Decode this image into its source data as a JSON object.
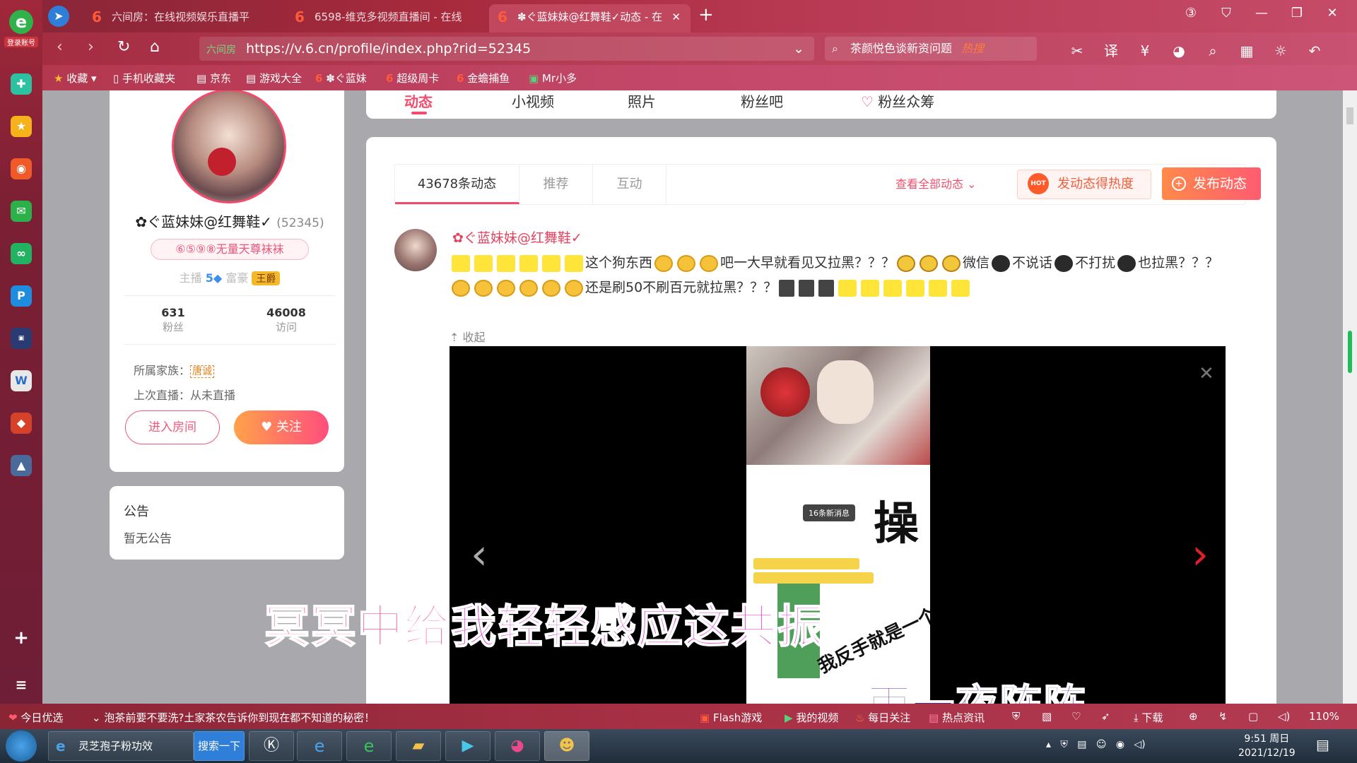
{
  "app": {
    "login_label": "登录账号"
  },
  "tabs": [
    {
      "label": "六间房：在线视频娱乐直播平"
    },
    {
      "label": "6598-维克多视频直播间 - 在线"
    },
    {
      "label": "✽ぐ蓝妹妹@红舞鞋✓动态 - 在"
    }
  ],
  "address": {
    "site_label": "六间房",
    "url": "https://v.6.cn/profile/index.php?rid=52345"
  },
  "search": {
    "text": "茶颜悦色谈新资问题",
    "hot": "热搜"
  },
  "bookmarks": [
    "收藏",
    "手机收藏夹",
    "京东",
    "游戏大全",
    "✽ぐ蓝妹",
    "超级周卡",
    "金蟾捕鱼",
    "Mr小多"
  ],
  "profile": {
    "name": "✿ぐ蓝妹妹@红舞鞋✓",
    "id": "(52345)",
    "badge": "⑥⑤⑨⑧无量天尊袜袜",
    "anchor_label": "主播",
    "anchor_level": "5",
    "rich_label": "富豪",
    "rich_title": "王爵",
    "fans_value": "631",
    "fans_label": "粉丝",
    "visits_value": "46008",
    "visits_label": "访问",
    "family_label": "所属家族：",
    "family_tag": "唐诚",
    "last_live": "上次直播：从未直播",
    "enter_room": "进入房间",
    "follow": "关注"
  },
  "notice": {
    "title": "公告",
    "body": "暂无公告"
  },
  "nav_tabs": [
    "动态",
    "小视频",
    "照片",
    "粉丝吧",
    "粉丝众筹"
  ],
  "feed": {
    "subtabs": [
      "43678条动态",
      "推荐",
      "互动"
    ],
    "view_all": "查看全部动态",
    "hot_button": "发动态得热度",
    "hot_icon": "HOT",
    "post_button": "发布动态",
    "post": {
      "author": "✿ぐ蓝妹妹@红舞鞋✓",
      "t1": "这个狗东西",
      "t2": "吧一大早就看见又拉黑？？？",
      "t3": "微信",
      "t4": "不说话",
      "t5": "不打扰",
      "t6": "也拉黑？？？",
      "t7": "还是刷50不刷百元就拉黑？？？",
      "collapse": "收起"
    },
    "image": {
      "big_char": "操",
      "msg": "16条新消息",
      "hand": "我反手就是一个耳巴子"
    }
  },
  "lyrics": {
    "line1_a": "冥冥中给",
    "line1_b": "我轻轻感应这共振",
    "line2": "雨一夜阵阵"
  },
  "statusbar": {
    "today": "今日优选",
    "news": "泡茶前要不要洗?土家茶农告诉你到现在都不知道的秘密！",
    "flash": "Flash游戏",
    "my_video": "我的视频",
    "daily": "每日关注",
    "hot_news": "热点资讯",
    "download": "下载",
    "zoom": "110%"
  },
  "taskbar": {
    "item1": "灵芝孢子粉功效",
    "search_btn": "搜索一下",
    "time": "9:51 周日",
    "date": "2021/12/19"
  }
}
